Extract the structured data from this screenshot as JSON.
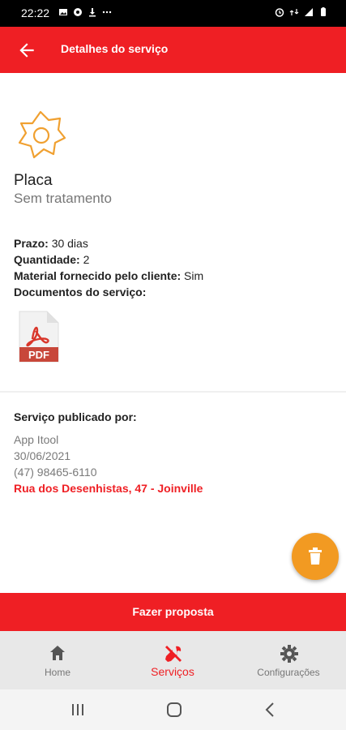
{
  "status_bar": {
    "time": "22:22"
  },
  "app_bar": {
    "title": "Detalhes do serviço"
  },
  "service": {
    "name": "Placa",
    "treatment": "Sem tratamento",
    "deadline_label": "Prazo:",
    "deadline_value": "30 dias",
    "quantity_label": "Quantidade:",
    "quantity_value": "2",
    "material_label": "Material fornecido pelo cliente:",
    "material_value": "Sim",
    "documents_label": "Documentos do serviço:",
    "document_icon_text": "PDF"
  },
  "publisher": {
    "header": "Serviço publicado por:",
    "name": "App Itool",
    "date": "30/06/2021",
    "phone": "(47) 98465-6110",
    "address": "Rua dos Desenhistas, 47 - Joinville"
  },
  "actions": {
    "proposal_button": "Fazer proposta"
  },
  "bottom_nav": {
    "items": [
      {
        "label": "Home",
        "icon": "home-icon"
      },
      {
        "label": "Serviços",
        "icon": "tools-icon",
        "active": true
      },
      {
        "label": "Configurações",
        "icon": "gear-icon"
      }
    ]
  },
  "colors": {
    "primary": "#ef1f24",
    "fab": "#f29a22",
    "icon_outline": "#f0a030"
  }
}
